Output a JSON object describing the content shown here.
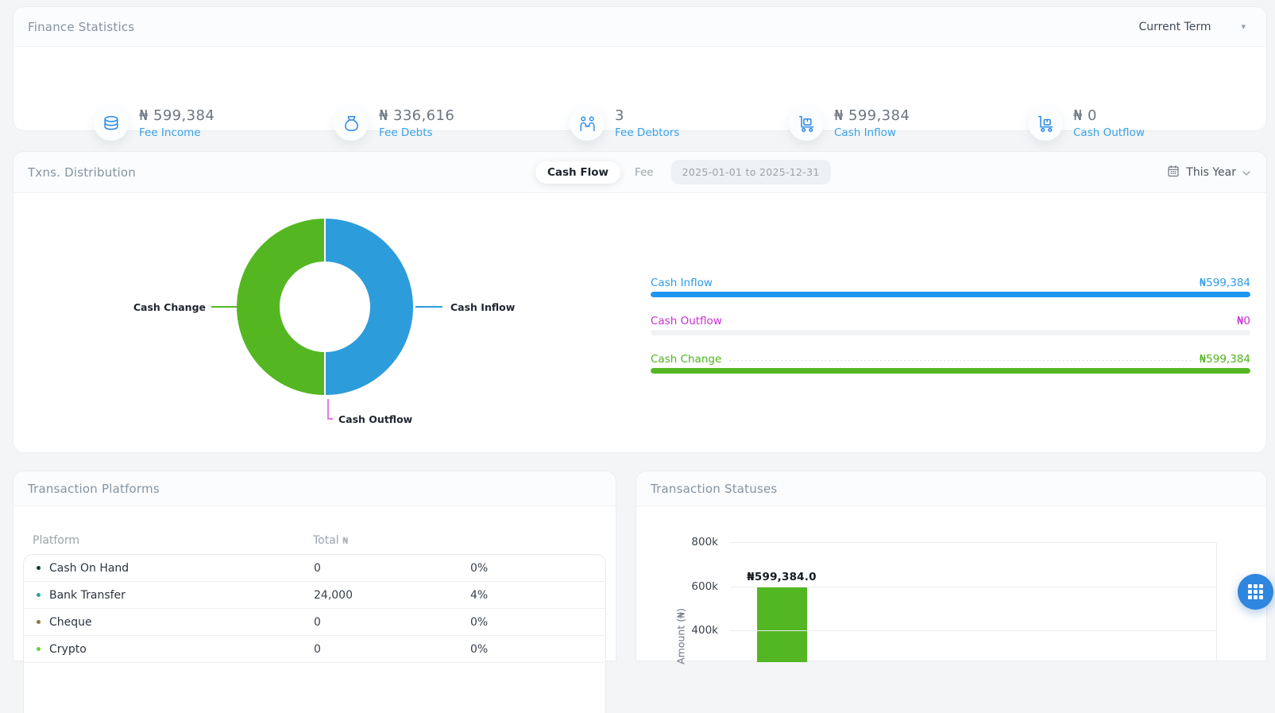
{
  "finance_statistics": {
    "title": "Finance Statistics",
    "term_selector": {
      "value": "Current Term"
    },
    "stats": [
      {
        "icon": "coins-icon",
        "value": "₦ 599,384",
        "label": "Fee Income"
      },
      {
        "icon": "money-bag-icon",
        "value": "₦ 336,616",
        "label": "Fee Debts"
      },
      {
        "icon": "debtors-icon",
        "value": "3",
        "label": "Fee Debtors"
      },
      {
        "icon": "cart-inflow-icon",
        "value": "₦ 599,384",
        "label": "Cash Inflow"
      },
      {
        "icon": "cart-outflow-icon",
        "value": "₦ 0",
        "label": "Cash Outflow"
      }
    ]
  },
  "txns_distribution": {
    "title": "Txns. Distribution",
    "tabs": [
      {
        "label": "Cash Flow",
        "active": true
      },
      {
        "label": "Fee",
        "active": false
      }
    ],
    "date_range": "2025-01-01 to 2025-12-31",
    "period_selector": {
      "value": "This Year",
      "icon": "calendar-icon"
    },
    "donut": {
      "callouts": [
        {
          "label": "Cash Inflow",
          "side": "right",
          "color": "#2d9cdb"
        },
        {
          "label": "Cash Change",
          "side": "left",
          "color": "#54b722"
        },
        {
          "label": "Cash Outflow",
          "side": "bottom",
          "color": "#e47ce8"
        }
      ]
    },
    "legend": [
      {
        "label": "Cash Inflow",
        "value": "₦599,384",
        "text_color": "#2d9ce8",
        "fill_color": "#1d96f2",
        "pct": 100,
        "leader": false
      },
      {
        "label": "Cash Outflow",
        "value": "₦0",
        "text_color": "#c92fd4",
        "fill_color": "#c92fd4",
        "pct": 0,
        "leader": false
      },
      {
        "label": "Cash Change",
        "value": "₦599,384",
        "text_color": "#50b31c",
        "fill_color": "#53b723",
        "pct": 100,
        "leader": true
      }
    ]
  },
  "transaction_platforms": {
    "title": "Transaction Platforms",
    "header_platform": "Platform",
    "header_total": "Total",
    "header_total_symbol": "₦",
    "rows": [
      {
        "dot": "#153c1f",
        "name": "Cash On Hand",
        "total": "0",
        "percent": "0%"
      },
      {
        "dot": "#27a69a",
        "name": "Bank Transfer",
        "total": "24,000",
        "percent": "4%"
      },
      {
        "dot": "#8b7d42",
        "name": "Cheque",
        "total": "0",
        "percent": "0%"
      },
      {
        "dot": "#5ed636",
        "name": "Crypto",
        "total": "0",
        "percent": "0%"
      }
    ]
  },
  "transaction_statuses": {
    "title": "Transaction Statuses",
    "y_axis_label": "Amount (₦)",
    "y_ticks": [
      "800k",
      "600k",
      "400k"
    ],
    "bar": {
      "data_label": "₦599,384.0",
      "color": "#53b723"
    }
  },
  "fab": {
    "icon": "grid-icon"
  },
  "chart_data": [
    {
      "type": "pie",
      "title": "Txns. Distribution — Cash Flow",
      "labels": [
        "Cash Inflow",
        "Cash Outflow",
        "Cash Change"
      ],
      "values": [
        599384,
        0,
        599384
      ],
      "colors": [
        "#2d9cdb",
        "#c92fd4",
        "#54b722"
      ],
      "hole": 0.5,
      "legend_position": "right"
    },
    {
      "type": "bar",
      "title": "Transaction Statuses",
      "categories": [
        ""
      ],
      "values": [
        599384
      ],
      "data_labels": [
        "₦599,384.0"
      ],
      "bar_color": "#53b723",
      "ylabel": "Amount (₦)",
      "ylim": [
        0,
        800000
      ],
      "yticks_visible": [
        "800k",
        "600k",
        "400k"
      ],
      "grid": true
    },
    {
      "type": "table",
      "title": "Transaction Platforms",
      "columns": [
        "Platform",
        "Total ₦",
        "%"
      ],
      "rows": [
        [
          "Cash On Hand",
          "0",
          "0%"
        ],
        [
          "Bank Transfer",
          "24,000",
          "4%"
        ],
        [
          "Cheque",
          "0",
          "0%"
        ],
        [
          "Crypto",
          "0",
          "0%"
        ]
      ]
    }
  ]
}
